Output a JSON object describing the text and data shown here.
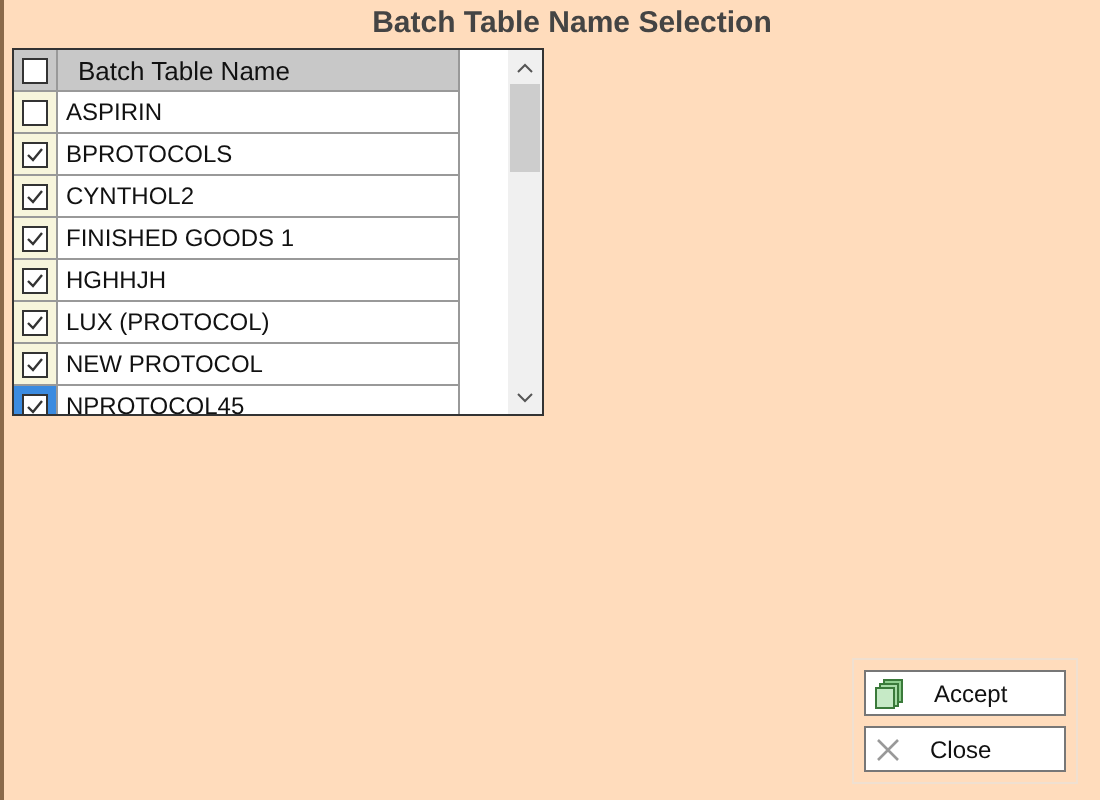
{
  "title": "Batch Table Name Selection",
  "grid": {
    "header": {
      "label": "Batch Table Name",
      "checked": false
    },
    "rows": [
      {
        "name": "ASPIRIN",
        "checked": false,
        "selected": false
      },
      {
        "name": "BPROTOCOLS",
        "checked": true,
        "selected": false
      },
      {
        "name": "CYNTHOL2",
        "checked": true,
        "selected": false
      },
      {
        "name": "FINISHED GOODS 1",
        "checked": true,
        "selected": false
      },
      {
        "name": "HGHHJH",
        "checked": true,
        "selected": false
      },
      {
        "name": "LUX (PROTOCOL)",
        "checked": true,
        "selected": false
      },
      {
        "name": "NEW PROTOCOL",
        "checked": true,
        "selected": false
      },
      {
        "name": "NPROTOCOL45",
        "checked": true,
        "selected": true
      }
    ]
  },
  "buttons": [
    {
      "label": "Accept",
      "kind": "accept"
    },
    {
      "label": "Close",
      "kind": "close"
    }
  ]
}
